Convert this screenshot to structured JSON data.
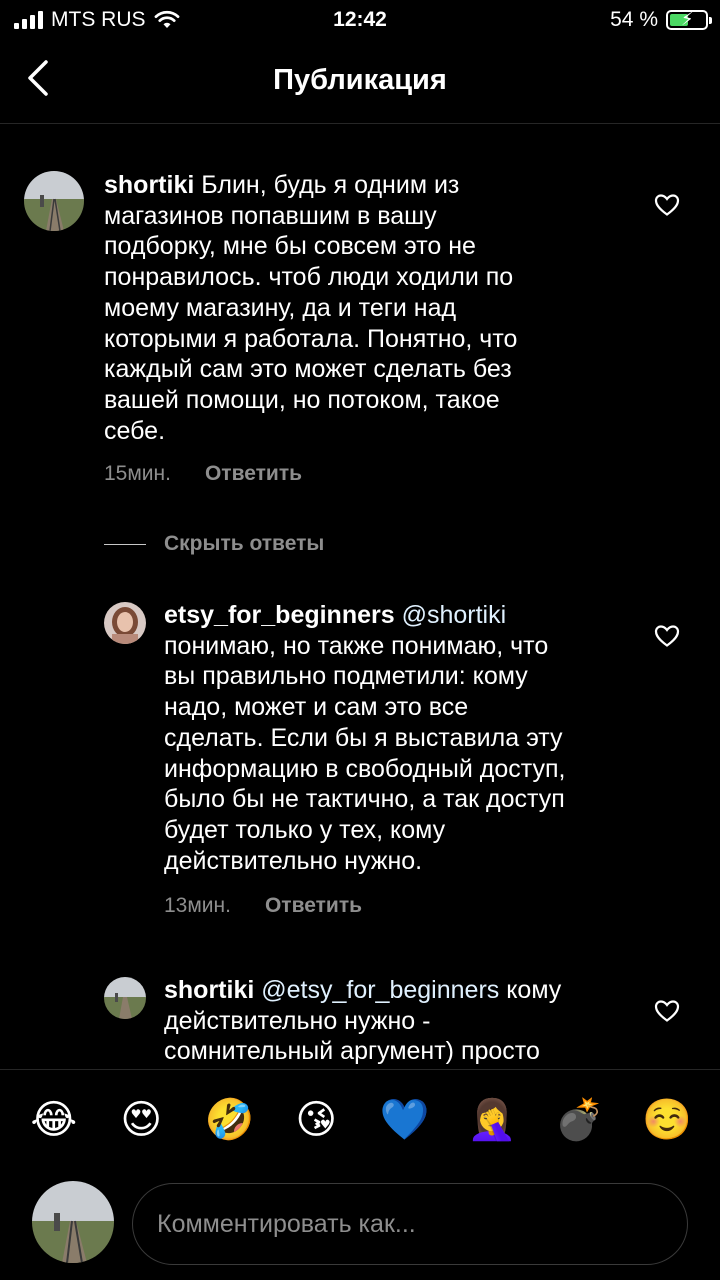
{
  "status_bar": {
    "carrier": "MTS RUS",
    "time": "12:42",
    "battery": "54 %",
    "battery_level": 0.54
  },
  "nav": {
    "title": "Публикация"
  },
  "comments": [
    {
      "username": "shortiki",
      "text_lines": [
        "Блин, будь я одним из",
        "магазинов попавшим в вашу",
        "подборку, мне бы совсем это не",
        "понравилось. чтоб люди ходили по",
        "моему магазину, да и теги над",
        "которыми я работала. Понятно, что",
        "каждый сам это может сделать без",
        "вашей помощи, но потоком, такое",
        "себе."
      ],
      "time": "15мин.",
      "reply_label": "Ответить"
    },
    {
      "username": "etsy_for_beginners",
      "mention": "@shortiki",
      "text_lines": [
        "понимаю, но также понимаю, что",
        "вы правильно подметили: кому",
        "надо, может и сам это все",
        "сделать. Если бы я выставила эту",
        "информацию в свободный доступ,",
        "было бы не тактично, а так доступ",
        "будет только у тех, кому",
        "действительно нужно."
      ],
      "time": "13мин.",
      "reply_label": "Ответить"
    },
    {
      "username": "shortiki",
      "mention": "@etsy_for_beginners",
      "first_line_rest": "кому",
      "text_lines": [
        "действительно нужно -",
        "сомнительный аргумент) просто"
      ]
    }
  ],
  "hide_replies_label": "Скрыть ответы",
  "emojis": [
    "😂",
    "😍",
    "🤣",
    "😘",
    "💙",
    "🤦‍♀️",
    "💣",
    "☺️"
  ],
  "comment_input": {
    "placeholder": "Комментировать как..."
  }
}
